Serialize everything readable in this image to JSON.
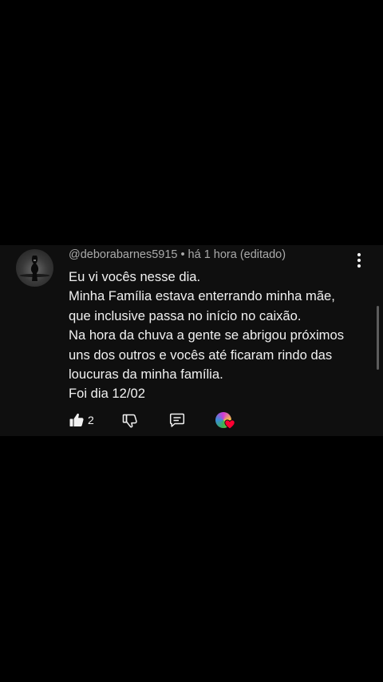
{
  "comment": {
    "author": "@deborabarnes5915",
    "separator": "•",
    "time": "há 1 hora (editado)",
    "lines": [
      "Eu vi vocês nesse dia.",
      "Minha Família estava enterrando minha mãe,",
      "que inclusive passa no início no caixão.",
      "Na hora da chuva a gente se abrigou próximos",
      "uns dos outros e vocês até ficaram rindo das",
      "loucuras da minha família.",
      "Foi dia 12/02"
    ],
    "like_count": "2"
  },
  "icons": {
    "like": "thumbs-up-icon",
    "dislike": "thumbs-down-icon",
    "reply": "reply-comment-icon",
    "more": "more-vertical-icon",
    "heart": "creator-heart-icon"
  },
  "colors": {
    "background": "#000000",
    "card": "#0f0f0f",
    "text": "#f1f1f1",
    "meta": "#aaaaaa",
    "heart": "#ff0033"
  }
}
